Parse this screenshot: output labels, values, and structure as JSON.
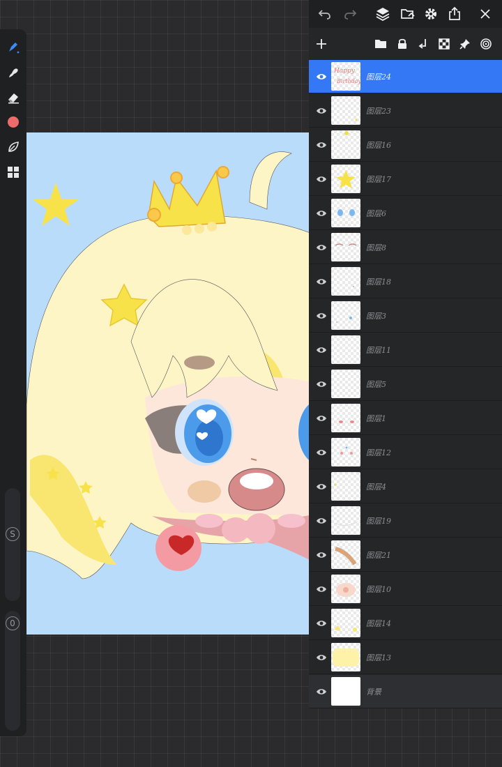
{
  "toolbar": {
    "tools": [
      "brush-icon",
      "smudge-icon",
      "eraser-icon",
      "color-swatch",
      "layer-leaf-icon",
      "gallery-grid-icon"
    ],
    "current_color": "#ee6b6b",
    "size_slider_label": "S",
    "opacity_slider_label": "0"
  },
  "top_bar": {
    "buttons": [
      "undo-icon",
      "redo-icon",
      "layers-icon",
      "import-icon",
      "settings-icon",
      "share-icon",
      "close-icon"
    ]
  },
  "layers_panel": {
    "actions": [
      "add-layer-icon",
      "folder-icon",
      "lock-icon",
      "merge-down-icon",
      "alpha-lock-icon",
      "pin-icon",
      "blend-icon"
    ],
    "accent": "#3478f6",
    "layers": [
      {
        "name": "图层24",
        "active": true,
        "thumb_text": "Happy Birthday"
      },
      {
        "name": "图层23",
        "active": false
      },
      {
        "name": "图层16",
        "active": false
      },
      {
        "name": "图层17",
        "active": false
      },
      {
        "name": "图层6",
        "active": false
      },
      {
        "name": "图层8",
        "active": false
      },
      {
        "name": "图层18",
        "active": false
      },
      {
        "name": "图层3",
        "active": false
      },
      {
        "name": "图层11",
        "active": false
      },
      {
        "name": "图层5",
        "active": false
      },
      {
        "name": "图层1",
        "active": false
      },
      {
        "name": "图层12",
        "active": false
      },
      {
        "name": "图层4",
        "active": false
      },
      {
        "name": "图层19",
        "active": false
      },
      {
        "name": "图层21",
        "active": false
      },
      {
        "name": "图层10",
        "active": false
      },
      {
        "name": "图层14",
        "active": false
      },
      {
        "name": "图层13",
        "active": false
      },
      {
        "name": "背景",
        "active": false,
        "background": true
      }
    ]
  },
  "canvas": {
    "background_color": "#b9dcfb",
    "hair_color": "#fdf5c6",
    "eye_color": "#4b9bea"
  }
}
